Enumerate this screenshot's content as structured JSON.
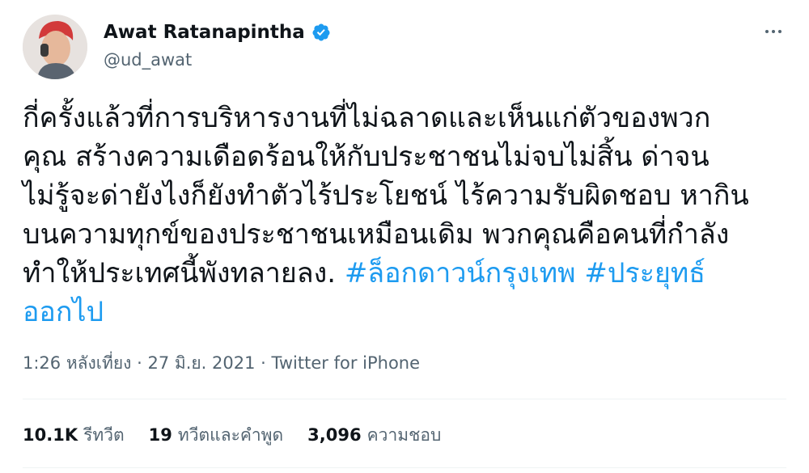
{
  "author": {
    "name": "Awat Ratanapintha",
    "handle": "@ud_awat",
    "verified": true
  },
  "tweet": {
    "lines": [
      [
        {
          "t": "กี่ครั้งแล้วที่การบริหารงานที่ไม่ฉลาดและเห็นแก่ตัวของพวก",
          "tag": false
        }
      ],
      [
        {
          "t": "คุณ สร้างความเดือดร้อนให้กับประชาชนไม่จบไม่สิ้น ด่าจน",
          "tag": false
        }
      ],
      [
        {
          "t": "ไม่รู้จะด่ายังไงก็ยังทำตัวไร้ประโยชน์ ไร้ความรับผิดชอบ หากิน",
          "tag": false
        }
      ],
      [
        {
          "t": "บนความทุกข์ของประชาชนเหมือนเดิม พวกคุณคือคนที่กำลัง",
          "tag": false
        }
      ],
      [
        {
          "t": "ทำให้ประเทศนี้พังทลายลง. ",
          "tag": false
        },
        {
          "t": "#ล็อกดาวน์กรุงเทพ",
          "tag": true
        },
        {
          "t": " ",
          "tag": false
        },
        {
          "t": "#ประยุทธ์",
          "tag": true
        }
      ],
      [
        {
          "t": "ออกไป",
          "tag": true
        }
      ]
    ]
  },
  "meta": {
    "time": "1:26 หลังเที่ยง",
    "separator": "·",
    "date": "27 มิ.ย. 2021",
    "source": "Twitter for iPhone"
  },
  "stats": [
    {
      "num": "10.1K",
      "label": "รีทวีต"
    },
    {
      "num": "19",
      "label": "ทวีตและคำพูด"
    },
    {
      "num": "3,096",
      "label": "ความชอบ"
    }
  ],
  "colors": {
    "link": "#1d9bf0",
    "text": "#0f1419",
    "secondary": "#536471"
  }
}
